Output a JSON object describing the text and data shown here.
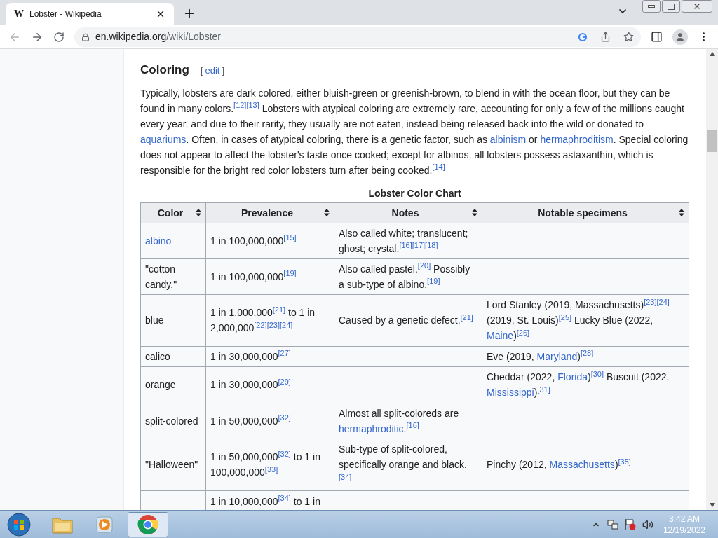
{
  "browser": {
    "logo": "W",
    "tab_title": "Lobster - Wikipedia",
    "url_host": "en.wikipedia.org",
    "url_path": "/wiki/Lobster"
  },
  "section": {
    "heading": "Coloring",
    "edit_open": "[",
    "edit_link": "edit",
    "edit_close": "]",
    "paragraph": [
      {
        "kind": "text",
        "text": "Typically, lobsters are dark colored, either bluish-green or greenish-brown, to blend in with the ocean floor, but they can be found in many colors."
      },
      {
        "kind": "ref",
        "text": "[12]"
      },
      {
        "kind": "ref",
        "text": "[13]"
      },
      {
        "kind": "text",
        "text": " Lobsters with atypical coloring are extremely rare, accounting for only a few of the millions caught every year, and due to their rarity, they usually are not eaten, instead being released back into the wild or donated to "
      },
      {
        "kind": "link",
        "text": "aquariums"
      },
      {
        "kind": "text",
        "text": ". Often, in cases of atypical coloring, there is a genetic factor, such as "
      },
      {
        "kind": "link",
        "text": "albinism"
      },
      {
        "kind": "text",
        "text": " or "
      },
      {
        "kind": "link",
        "text": "hermaphroditism"
      },
      {
        "kind": "text",
        "text": ". Special coloring does not appear to affect the lobster's taste once cooked; except for albinos, all lobsters possess astaxanthin, which is responsible for the bright red color lobsters turn after being cooked."
      },
      {
        "kind": "ref",
        "text": "[14]"
      }
    ]
  },
  "table": {
    "caption": "Lobster Color Chart",
    "columns": [
      "Color",
      "Prevalence",
      "Notes",
      "Notable specimens"
    ],
    "rows": [
      [
        [
          {
            "kind": "link",
            "text": "albino"
          }
        ],
        [
          {
            "kind": "text",
            "text": "1 in 100,000,000"
          },
          {
            "kind": "ref",
            "text": "[15]"
          }
        ],
        [
          {
            "kind": "text",
            "text": "Also called white; translucent; ghost; crystal."
          },
          {
            "kind": "ref",
            "text": "[16]"
          },
          {
            "kind": "ref",
            "text": "[17]"
          },
          {
            "kind": "ref",
            "text": "[18]"
          }
        ],
        []
      ],
      [
        [
          {
            "kind": "text",
            "text": "\"cotton candy.\""
          }
        ],
        [
          {
            "kind": "text",
            "text": "1 in 100,000,000"
          },
          {
            "kind": "ref",
            "text": "[19]"
          }
        ],
        [
          {
            "kind": "text",
            "text": "Also called pastel."
          },
          {
            "kind": "ref",
            "text": "[20]"
          },
          {
            "kind": "text",
            "text": " Possibly a sub-type of albino."
          },
          {
            "kind": "ref",
            "text": "[19]"
          }
        ],
        []
      ],
      [
        [
          {
            "kind": "text",
            "text": "blue"
          }
        ],
        [
          {
            "kind": "text",
            "text": "1 in 1,000,000"
          },
          {
            "kind": "ref",
            "text": "[21]"
          },
          {
            "kind": "text",
            "text": " to 1 in 2,000,000"
          },
          {
            "kind": "ref",
            "text": "[22]"
          },
          {
            "kind": "ref",
            "text": "[23]"
          },
          {
            "kind": "ref",
            "text": "[24]"
          }
        ],
        [
          {
            "kind": "text",
            "text": "Caused by a genetic defect."
          },
          {
            "kind": "ref",
            "text": "[21]"
          }
        ],
        [
          {
            "kind": "text",
            "text": "Lord Stanley (2019, Massachusetts)"
          },
          {
            "kind": "ref",
            "text": "[23]"
          },
          {
            "kind": "ref",
            "text": "[24]"
          },
          {
            "kind": "text",
            "text": " (2019, St. Louis)"
          },
          {
            "kind": "ref",
            "text": "[25]"
          },
          {
            "kind": "text",
            "text": " Lucky Blue (2022, "
          },
          {
            "kind": "link",
            "text": "Maine"
          },
          {
            "kind": "text",
            "text": ")"
          },
          {
            "kind": "ref",
            "text": "[26]"
          }
        ]
      ],
      [
        [
          {
            "kind": "text",
            "text": "calico"
          }
        ],
        [
          {
            "kind": "text",
            "text": "1 in 30,000,000"
          },
          {
            "kind": "ref",
            "text": "[27]"
          }
        ],
        [],
        [
          {
            "kind": "text",
            "text": "Eve (2019, "
          },
          {
            "kind": "link",
            "text": "Maryland"
          },
          {
            "kind": "text",
            "text": ")"
          },
          {
            "kind": "ref",
            "text": "[28]"
          }
        ]
      ],
      [
        [
          {
            "kind": "text",
            "text": "orange"
          }
        ],
        [
          {
            "kind": "text",
            "text": "1 in 30,000,000"
          },
          {
            "kind": "ref",
            "text": "[29]"
          }
        ],
        [],
        [
          {
            "kind": "text",
            "text": "Cheddar (2022, "
          },
          {
            "kind": "link",
            "text": "Florida"
          },
          {
            "kind": "text",
            "text": ")"
          },
          {
            "kind": "ref",
            "text": "[30]"
          },
          {
            "kind": "text",
            "text": " Buscuit (2022, "
          },
          {
            "kind": "link",
            "text": "Mississippi"
          },
          {
            "kind": "text",
            "text": ")"
          },
          {
            "kind": "ref",
            "text": "[31]"
          }
        ]
      ],
      [
        [
          {
            "kind": "text",
            "text": "split-colored"
          }
        ],
        [
          {
            "kind": "text",
            "text": "1 in 50,000,000"
          },
          {
            "kind": "ref",
            "text": "[32]"
          }
        ],
        [
          {
            "kind": "text",
            "text": "Almost all split-coloreds are "
          },
          {
            "kind": "link",
            "text": "hermaphroditic"
          },
          {
            "kind": "text",
            "text": "."
          },
          {
            "kind": "ref",
            "text": "[16]"
          }
        ],
        []
      ],
      [
        [
          {
            "kind": "text",
            "text": "\"Halloween\""
          }
        ],
        [
          {
            "kind": "text",
            "text": "1 in 50,000,000"
          },
          {
            "kind": "ref",
            "text": "[32]"
          },
          {
            "kind": "text",
            "text": " to 1 in 100,000,000"
          },
          {
            "kind": "ref",
            "text": "[33]"
          }
        ],
        [
          {
            "kind": "text",
            "text": "Sub-type of split-colored, specifically orange and black."
          },
          {
            "kind": "ref",
            "text": "[34]"
          }
        ],
        [
          {
            "kind": "text",
            "text": "Pinchy (2012, "
          },
          {
            "kind": "link",
            "text": "Massachusetts"
          },
          {
            "kind": "text",
            "text": ")"
          },
          {
            "kind": "ref",
            "text": "[35]"
          }
        ]
      ],
      [
        [],
        [
          {
            "kind": "text",
            "text": "1 in 10,000,000"
          },
          {
            "kind": "ref",
            "text": "[34]"
          },
          {
            "kind": "text",
            "text": " to 1 in"
          }
        ],
        [],
        []
      ]
    ]
  },
  "taskbar": {
    "time": "3:42 AM",
    "date": "12/19/2022"
  }
}
